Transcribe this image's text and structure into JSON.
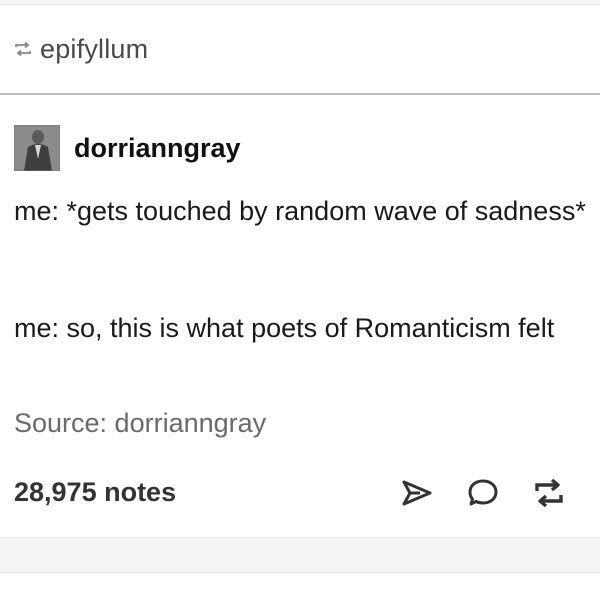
{
  "reblog": {
    "icon": "reblog-icon",
    "name": "epifyllum"
  },
  "post": {
    "author": {
      "name": "dorrianngray",
      "avatar": "avatar-image"
    },
    "lines": [
      "me: *gets touched by random wave of sadness*",
      "me: so, this is what poets of Romanticism felt"
    ],
    "source": "Source: dorrianngray"
  },
  "footer": {
    "notes": "28,975 notes",
    "actions": [
      "share-icon",
      "reply-icon",
      "reblog-icon"
    ]
  }
}
